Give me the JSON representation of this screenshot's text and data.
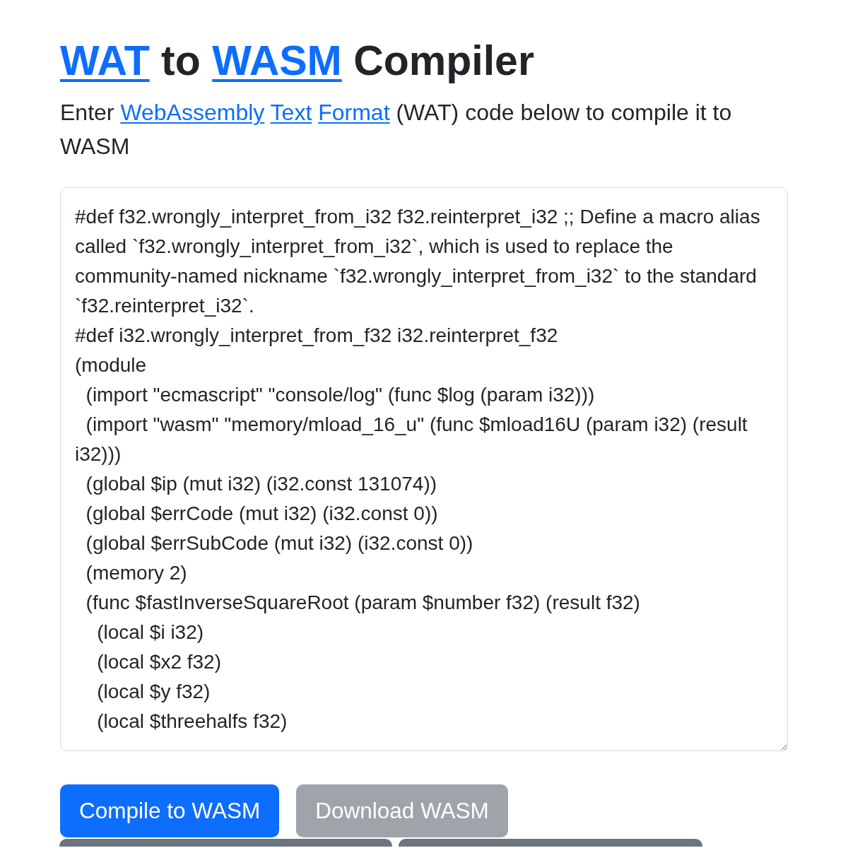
{
  "header": {
    "title": [
      {
        "kind": "link",
        "text": "WAT"
      },
      {
        "kind": "text",
        "text": "to"
      },
      {
        "kind": "link",
        "text": "WASM"
      },
      {
        "kind": "text",
        "text": "Compiler"
      }
    ],
    "intro": [
      {
        "kind": "text",
        "text": "Enter"
      },
      {
        "kind": "link",
        "text": "WebAssembly"
      },
      {
        "kind": "link",
        "text": "Text"
      },
      {
        "kind": "link",
        "text": "Format"
      },
      {
        "kind": "text",
        "text": "(WAT) code below to compile it to WASM"
      }
    ]
  },
  "editor": {
    "value": "#def f32.wrongly_interpret_from_i32 f32.reinterpret_i32 ;; Define a macro alias called `f32.wrongly_interpret_from_i32`, which is used to replace the community-named nickname `f32.wrongly_interpret_from_i32` to the standard `f32.reinterpret_i32`.\n#def i32.wrongly_interpret_from_f32 i32.reinterpret_f32\n(module\n  (import \"ecmascript\" \"console/log\" (func $log (param i32)))\n  (import \"wasm\" \"memory/mload_16_u\" (func $mload16U (param i32) (result i32)))\n  (global $ip (mut i32) (i32.const 131074))\n  (global $errCode (mut i32) (i32.const 0))\n  (global $errSubCode (mut i32) (i32.const 0))\n  (memory 2)\n  (func $fastInverseSquareRoot (param $number f32) (result f32)\n    (local $i i32)\n    (local $x2 f32)\n    (local $y f32)\n    (local $threehalfs f32)"
  },
  "button_rows": [
    [
      {
        "kind": "primary",
        "label": "Compile to WASM",
        "disabled": false
      },
      {
        "kind": "secondary",
        "label": "Download WASM",
        "disabled": true
      }
    ],
    [
      {
        "kind": "secondary",
        "disabled": false
      },
      {
        "kind": "secondary",
        "disabled": false
      }
    ]
  ]
}
